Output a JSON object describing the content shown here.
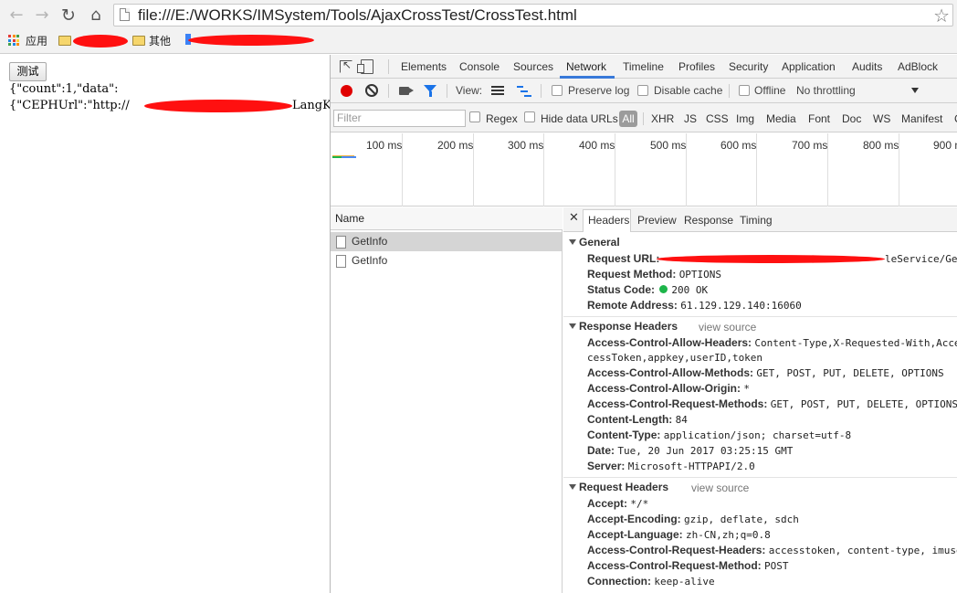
{
  "browser": {
    "url": "file:///E:/WORKS/IMSystem/Tools/AjaxCrossTest/CrossTest.html",
    "bookmarks": {
      "apps_label": "应用",
      "other_label": "其他"
    }
  },
  "page": {
    "test_button": "测试",
    "json_line1": "{\"count\":1,\"data\":",
    "json_line2_start": "{\"CEPHUrl\":\"http://",
    "json_line2_end": "LangK"
  },
  "devtools": {
    "tabs": [
      "Elements",
      "Console",
      "Sources",
      "Network",
      "Timeline",
      "Profiles",
      "Security",
      "Application",
      "Audits",
      "AdBlock"
    ],
    "active_tab": "Network",
    "toolbar": {
      "view_label": "View:",
      "preserve_log": "Preserve log",
      "disable_cache": "Disable cache",
      "offline": "Offline",
      "throttling": "No throttling"
    },
    "filter": {
      "placeholder": "Filter",
      "regex": "Regex",
      "hide_data_urls": "Hide data URLs",
      "all": "All",
      "types": [
        "XHR",
        "JS",
        "CSS",
        "Img",
        "Media",
        "Font",
        "Doc",
        "WS",
        "Manifest",
        "C"
      ]
    },
    "timeline_ticks": [
      "100 ms",
      "200 ms",
      "300 ms",
      "400 ms",
      "500 ms",
      "600 ms",
      "700 ms",
      "800 ms",
      "900 m"
    ],
    "name_header": "Name",
    "requests": [
      {
        "name": "GetInfo",
        "selected": true
      },
      {
        "name": "GetInfo",
        "selected": false
      }
    ],
    "detail_tabs": [
      "Headers",
      "Preview",
      "Response",
      "Timing"
    ],
    "general": {
      "title": "General",
      "request_url_key": "Request URL:",
      "request_url_tail": "leService/Ge",
      "request_method_key": "Request Method:",
      "request_method": "OPTIONS",
      "status_code_key": "Status Code:",
      "status_code": "200 OK",
      "remote_address_key": "Remote Address:",
      "remote_address": "61.129.129.140:16060"
    },
    "response_headers": {
      "title": "Response Headers",
      "view_source": "view source",
      "rows": [
        {
          "key": "Access-Control-Allow-Headers:",
          "value": "Content-Type,X-Requested-With,Acce"
        },
        {
          "key": "",
          "value": "cessToken,appkey,userID,token"
        },
        {
          "key": "Access-Control-Allow-Methods:",
          "value": "GET, POST, PUT, DELETE, OPTIONS"
        },
        {
          "key": "Access-Control-Allow-Origin:",
          "value": "*"
        },
        {
          "key": "Access-Control-Request-Methods:",
          "value": "GET, POST, PUT, DELETE, OPTIONS"
        },
        {
          "key": "Content-Length:",
          "value": "84"
        },
        {
          "key": "Content-Type:",
          "value": "application/json; charset=utf-8"
        },
        {
          "key": "Date:",
          "value": "Tue, 20 Jun 2017 03:25:15 GMT"
        },
        {
          "key": "Server:",
          "value": "Microsoft-HTTPAPI/2.0"
        }
      ]
    },
    "request_headers": {
      "title": "Request Headers",
      "view_source": "view source",
      "rows": [
        {
          "key": "Accept:",
          "value": "*/*"
        },
        {
          "key": "Accept-Encoding:",
          "value": "gzip, deflate, sdch"
        },
        {
          "key": "Accept-Language:",
          "value": "zh-CN,zh;q=0.8"
        },
        {
          "key": "Access-Control-Request-Headers:",
          "value": "accesstoken, content-type, imuse"
        },
        {
          "key": "Access-Control-Request-Method:",
          "value": "POST"
        },
        {
          "key": "Connection:",
          "value": "keep-alive"
        }
      ]
    },
    "colors": {
      "accent": "#3879d9",
      "record": "#e00000",
      "status_ok": "#1db54a",
      "redaction": "#ff1010"
    }
  }
}
